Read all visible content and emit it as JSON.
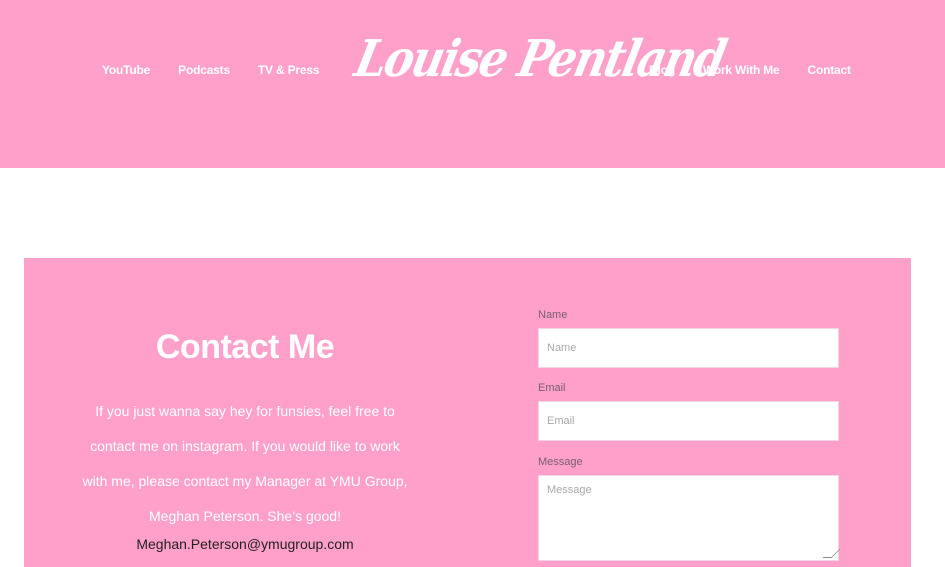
{
  "header": {
    "nav_left": [
      {
        "label": "YouTube"
      },
      {
        "label": "Podcasts"
      },
      {
        "label": "TV & Press"
      }
    ],
    "logo": "Louise Pentland",
    "nav_right": [
      {
        "label": "Blog"
      },
      {
        "label": "Work With Me"
      },
      {
        "label": "Contact"
      }
    ]
  },
  "contact": {
    "title": "Contact Me",
    "body": "If you just wanna say hey for funsies, feel free to contact me on instagram. If you would like to work with me, please contact my Manager at YMU Group, Meghan Peterson. She’s good!",
    "email": "Meghan.Peterson@ymugroup.com"
  },
  "form": {
    "name_label": "Name",
    "name_placeholder": "Name",
    "email_label": "Email",
    "email_placeholder": "Email",
    "message_label": "Message",
    "message_placeholder": "Message"
  },
  "colors": {
    "brand_pink": "#ffa0cb",
    "white": "#ffffff"
  }
}
